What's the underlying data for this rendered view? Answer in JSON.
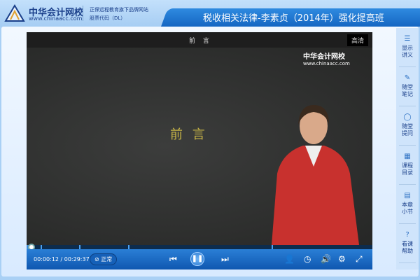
{
  "header": {
    "brand": "中华会计网校",
    "url": "www.chinaacc.com",
    "tagline": "正保远程教育旗下品牌网站",
    "stock": "股票代码（DL）",
    "course_title": "税收相关法律-李素贞（2014年）强化提高班"
  },
  "video": {
    "title": "前 言",
    "quality": "高清",
    "slide_text": "前 言",
    "watermark_brand": "中华会计网校",
    "watermark_url": "www.chinaacc.com",
    "progress_fraction": 0.007
  },
  "controls": {
    "current_time": "00:00:12",
    "separator": "/",
    "total_time": "00:29:37",
    "speed": "正常"
  },
  "sidebar": {
    "items": [
      {
        "label": "显示讲义",
        "icon": "list-icon"
      },
      {
        "label": "随堂笔记",
        "icon": "pencil-icon"
      },
      {
        "label": "随堂提问",
        "icon": "chat-icon"
      },
      {
        "label": "课程目录",
        "icon": "grid-icon"
      },
      {
        "label": "本章小节",
        "icon": "document-icon"
      },
      {
        "label": "看课帮助",
        "icon": "help-icon"
      }
    ]
  }
}
